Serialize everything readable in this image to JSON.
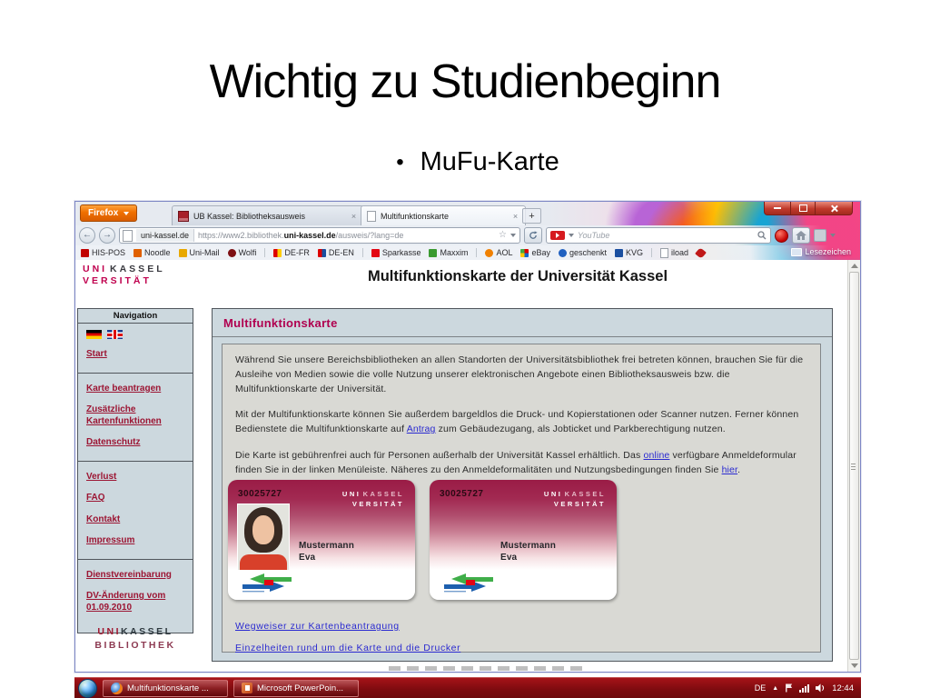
{
  "slide": {
    "title": "Wichtig zu Studienbeginn",
    "bullet_symbol": "•",
    "bullet_text": "MuFu-Karte"
  },
  "glyphs": {
    "back": "←",
    "forward": "→",
    "star": "☆",
    "new_tab": "+",
    "tray_arrow": "▲"
  },
  "colors": {
    "accent_magenta": "#b0004f",
    "link_blue": "#2a2ad0",
    "sidebar_link": "#9c1533",
    "taskbar_red": "#8f1013",
    "card_maroon": "#9a1c46"
  },
  "browser": {
    "menu_button": "Firefox",
    "tabs": [
      {
        "title": "UB Kassel: Bibliotheksausweis"
      },
      {
        "title": "Multifunktionskarte"
      }
    ],
    "urlbar": {
      "site_chip": "uni-kassel.de",
      "url_prefix": "https://www2.bibliothek.",
      "url_domain": "uni-kassel.de",
      "url_suffix": "/ausweis/?lang=de"
    },
    "searchbar": {
      "placeholder": "YouTube"
    },
    "bookmarks": [
      "HIS-POS",
      "Noodle",
      "Uni-Mail",
      "Wolfi",
      "DE-FR",
      "DE-EN",
      "Sparkasse",
      "Maxxim",
      "AOL",
      "eBay",
      "geschenkt",
      "KVG",
      "iload"
    ],
    "bookmarks_overflow_label": "Lesezeichen"
  },
  "uni_logo": {
    "uni": "UNI",
    "kassel": "KASSEL",
    "versitaet": "VERSITÄT"
  },
  "bib_logo": {
    "uni": "UNI",
    "kassel": "KASSEL",
    "bibliothek": "BIBLIOTHEK"
  },
  "page": {
    "heading": "Multifunktionskarte der Universität Kassel",
    "sidebar": {
      "title": "Navigation",
      "items": [
        "Start",
        "Karte beantragen",
        "Zusätzliche Kartenfunktionen",
        "Datenschutz",
        "Verlust",
        "FAQ",
        "Kontakt",
        "Impressum",
        "Dienstvereinbarung",
        "DV-Änderung vom 01.09.2010"
      ]
    },
    "content": {
      "heading": "Multifunktionskarte",
      "p1": "Während Sie unsere Bereichsbibliotheken an allen Standorten der Universitätsbibliothek frei betreten können, brauchen Sie für die Ausleihe von Medien sowie die volle Nutzung unserer elektronischen Angebote einen Bibliotheksausweis bzw. die Multifunktionskarte der Universität.",
      "p2_pre": "Mit der Multifunktionskarte können Sie außerdem bargeldlos die Druck- und Kopierstationen oder Scanner nutzen. Ferner können Bedienstete die Multifunktionskarte auf ",
      "p2_link": "Antrag",
      "p2_post": " zum Gebäudezugang, als Jobticket und Parkberechtigung nutzen.",
      "p3_pre": "Die Karte ist gebührenfrei auch für Personen außerhalb der Universität Kassel erhältlich. Das ",
      "p3_link1": "online",
      "p3_mid": " verfügbare Anmeldeformular finden Sie in der linken Menüleiste. Näheres zu den Anmeldeformalitäten und Nutzungsbedingungen finden Sie ",
      "p3_link2": "hier",
      "p3_post": ".",
      "cards": [
        {
          "number": "30025727",
          "name1": "Mustermann",
          "name2": "Eva"
        },
        {
          "number": "30025727",
          "name1": "Mustermann",
          "name2": "Eva"
        }
      ],
      "links": [
        "Wegweiser zur Kartenbeantragung",
        "Einzelheiten rund um die Karte und die Drucker"
      ]
    }
  },
  "taskbar": {
    "tasks": [
      {
        "label": "Multifunktionskarte ..."
      },
      {
        "label": "Microsoft PowerPoin..."
      }
    ],
    "tray_lang": "DE",
    "tray_time": "12:44"
  }
}
